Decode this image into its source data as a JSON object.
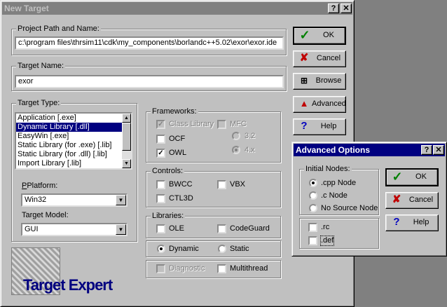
{
  "main": {
    "title": "New Target",
    "help_glyph": "?",
    "close_glyph": "✕",
    "project_group": "Project Path and Name:",
    "project_path": "c:\\program files\\thrsim11\\cdk\\my_components\\borlandc++5.02\\exor\\exor.ide",
    "target_name_group": "Target Name:",
    "target_name": "exor",
    "target_type_group": "Target Type:",
    "target_types": [
      "Application [.exe]",
      "Dynamic Library [.dll]",
      "EasyWin [.exe]",
      "Static Library (for .exe) [.lib]",
      "Static Library (for .dll) [.lib]",
      "Import Library [.lib]"
    ],
    "platform_label": "Platform:",
    "platform_value": "Win32",
    "target_model_label": "Target Model:",
    "target_model_value": "GUI",
    "frameworks_group": "Frameworks:",
    "class_library": "Class Library",
    "mfc": "MFC",
    "ocf": "OCF",
    "owl": "OWL",
    "v32": "3.2",
    "v4x": "4.x",
    "controls_group": "Controls:",
    "bwcc": "BWCC",
    "vbx": "VBX",
    "ctl3d": "CTL3D",
    "libraries_group": "Libraries:",
    "ole": "OLE",
    "codeguard": "CodeGuard",
    "dynamic": "Dynamic",
    "static": "Static",
    "diagnostic": "Diagnostic",
    "multithread": "Multithread",
    "logo_text": "Target Expert",
    "buttons": {
      "ok": "OK",
      "cancel": "Cancel",
      "browse": "Browse",
      "advanced": "Advanced",
      "help": "Help"
    },
    "check_mark": "✓"
  },
  "advanced": {
    "title": "Advanced Options",
    "help_glyph": "?",
    "close_glyph": "✕",
    "initial_nodes_group": "Initial Nodes:",
    "cpp_node": ".cpp Node",
    "c_node": ".c Node",
    "no_source_node": "No Source Node",
    "rc": ".rc",
    "def": ".def",
    "buttons": {
      "ok": "OK",
      "cancel": "Cancel",
      "help": "Help"
    }
  },
  "colors": {
    "title_active": "#000080",
    "title_inactive": "#808080",
    "ok_green": "#008000",
    "cancel_red": "#c00000",
    "help_blue": "#0000c0",
    "logo_blue": "#000080"
  },
  "icons": {
    "ok": "green-check-icon",
    "cancel": "red-x-icon",
    "browse": "tree-browse-icon",
    "advanced": "toolbox-icon",
    "help": "question-mark-icon"
  }
}
